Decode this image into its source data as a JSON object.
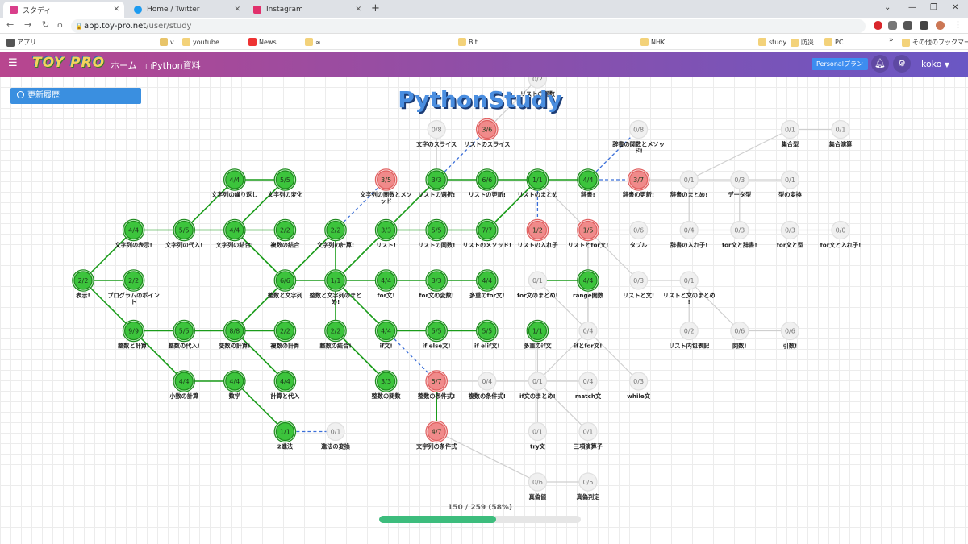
{
  "browser": {
    "tabs": [
      {
        "title": "スタディ",
        "active": true
      },
      {
        "title": "Home / Twitter",
        "active": false
      },
      {
        "title": "Instagram",
        "active": false
      }
    ],
    "url_host": "app.toy-pro.net",
    "url_path": "/user/study"
  },
  "bookmarks": [
    "アプリ",
    "v",
    "youtube",
    "News",
    "∞",
    "Bit",
    "NHK",
    "study",
    "防災",
    "PC",
    "その他のブックマーク"
  ],
  "header": {
    "logo": "TOY PRO",
    "nav": [
      "ホーム",
      "Python資料"
    ],
    "plan_label": "Personalプラン",
    "user_name": "koko"
  },
  "main": {
    "history_button": "更新履歴",
    "title": "PythonStudy",
    "progress_text": "150 / 259 (58%)",
    "progress_fraction": 0.58
  },
  "colors": {
    "completed": "#3cc43c",
    "in_progress": "#f08a8a",
    "not_started": "#f0f0f0",
    "edge_done": "#1a9c1a",
    "edge_todo": "#cfcfcf",
    "edge_link": "#3b6fd8"
  },
  "nodes": [
    {
      "id": "n1",
      "count": "2/2",
      "label": "表示!",
      "status": "done",
      "gx": 1,
      "gy": 4
    },
    {
      "id": "n2",
      "count": "2/2",
      "label": "プログラムのポイント",
      "status": "done",
      "gx": 2,
      "gy": 4
    },
    {
      "id": "n3",
      "count": "4/4",
      "label": "文字列の表示!",
      "status": "done",
      "gx": 2,
      "gy": 3
    },
    {
      "id": "n4",
      "count": "9/9",
      "label": "整数と計算!",
      "status": "done",
      "gx": 2,
      "gy": 5
    },
    {
      "id": "n5",
      "count": "5/5",
      "label": "文字列の代入!",
      "status": "done",
      "gx": 3,
      "gy": 3
    },
    {
      "id": "n6",
      "count": "5/5",
      "label": "整数の代入!",
      "status": "done",
      "gx": 3,
      "gy": 5
    },
    {
      "id": "n7",
      "count": "4/4",
      "label": "小数の計算",
      "status": "done",
      "gx": 3,
      "gy": 6
    },
    {
      "id": "n8",
      "count": "4/4",
      "label": "文字列の繰り返し",
      "status": "done",
      "gx": 4,
      "gy": 2
    },
    {
      "id": "n9",
      "count": "4/4",
      "label": "文字列の結合!",
      "status": "done",
      "gx": 4,
      "gy": 3
    },
    {
      "id": "n10",
      "count": "8/8",
      "label": "変数の計算!",
      "status": "done",
      "gx": 4,
      "gy": 5
    },
    {
      "id": "n11",
      "count": "4/4",
      "label": "数学",
      "status": "done",
      "gx": 4,
      "gy": 6
    },
    {
      "id": "n12",
      "count": "5/5",
      "label": "文字列の変化",
      "status": "done",
      "gx": 5,
      "gy": 2
    },
    {
      "id": "n13",
      "count": "2/2",
      "label": "複数の結合",
      "status": "done",
      "gx": 5,
      "gy": 3
    },
    {
      "id": "n14",
      "count": "6/6",
      "label": "整数と文字列",
      "status": "done",
      "gx": 5,
      "gy": 4
    },
    {
      "id": "n15",
      "count": "2/2",
      "label": "複数の計算",
      "status": "done",
      "gx": 5,
      "gy": 5
    },
    {
      "id": "n16",
      "count": "4/4",
      "label": "計算と代入",
      "status": "done",
      "gx": 5,
      "gy": 6
    },
    {
      "id": "n17",
      "count": "1/1",
      "label": "2進法",
      "status": "done",
      "gx": 5,
      "gy": 7
    },
    {
      "id": "n18",
      "count": "0/1",
      "label": "進法の変換",
      "status": "todo",
      "gx": 6,
      "gy": 7
    },
    {
      "id": "n19",
      "count": "2/2",
      "label": "文字列の計算!",
      "status": "done",
      "gx": 6,
      "gy": 3
    },
    {
      "id": "n20",
      "count": "1/1",
      "label": "整数と文字列のまとめ!",
      "status": "done",
      "gx": 6,
      "gy": 4
    },
    {
      "id": "n21",
      "count": "2/2",
      "label": "整数の結合!",
      "status": "done",
      "gx": 6,
      "gy": 5
    },
    {
      "id": "n22",
      "count": "3/5",
      "label": "文字列の関数とメソッド",
      "status": "prog",
      "gx": 7,
      "gy": 2
    },
    {
      "id": "n23",
      "count": "3/3",
      "label": "リスト!",
      "status": "done",
      "gx": 7,
      "gy": 3
    },
    {
      "id": "n24",
      "count": "4/4",
      "label": "for文!",
      "status": "done",
      "gx": 7,
      "gy": 4
    },
    {
      "id": "n25",
      "count": "4/4",
      "label": "if文!",
      "status": "done",
      "gx": 7,
      "gy": 5
    },
    {
      "id": "n26",
      "count": "3/3",
      "label": "整数の関数",
      "status": "done",
      "gx": 7,
      "gy": 6
    },
    {
      "id": "n27",
      "count": "0/8",
      "label": "文字のスライス",
      "status": "todo",
      "gx": 8,
      "gy": 1
    },
    {
      "id": "n28",
      "count": "3/3",
      "label": "リストの選択!",
      "status": "done",
      "gx": 8,
      "gy": 2
    },
    {
      "id": "n29",
      "count": "5/5",
      "label": "リストの関数!",
      "status": "done",
      "gx": 8,
      "gy": 3
    },
    {
      "id": "n30",
      "count": "3/3",
      "label": "for文の変数!",
      "status": "done",
      "gx": 8,
      "gy": 4
    },
    {
      "id": "n31",
      "count": "5/5",
      "label": "if else文!",
      "status": "done",
      "gx": 8,
      "gy": 5
    },
    {
      "id": "n32",
      "count": "5/7",
      "label": "整数の条件式!",
      "status": "prog",
      "gx": 8,
      "gy": 6
    },
    {
      "id": "n33",
      "count": "4/7",
      "label": "文字列の条件式",
      "status": "prog",
      "gx": 8,
      "gy": 7
    },
    {
      "id": "n34",
      "count": "3/6",
      "label": "リストのスライス",
      "status": "prog",
      "gx": 9,
      "gy": 1
    },
    {
      "id": "n35",
      "count": "6/6",
      "label": "リストの更新!",
      "status": "done",
      "gx": 9,
      "gy": 2
    },
    {
      "id": "n36",
      "count": "7/7",
      "label": "リストのメソッド!",
      "status": "done",
      "gx": 9,
      "gy": 3
    },
    {
      "id": "n37",
      "count": "4/4",
      "label": "多重のfor文!",
      "status": "done",
      "gx": 9,
      "gy": 4
    },
    {
      "id": "n38",
      "count": "5/5",
      "label": "if elif文!",
      "status": "done",
      "gx": 9,
      "gy": 5
    },
    {
      "id": "n39",
      "count": "0/4",
      "label": "複数の条件式!",
      "status": "todo",
      "gx": 9,
      "gy": 6
    },
    {
      "id": "n40",
      "count": "0/2",
      "label": "リストの関数",
      "status": "todo",
      "gx": 10,
      "gy": 0
    },
    {
      "id": "n41",
      "count": "1/1",
      "label": "リストのまとめ",
      "status": "done",
      "gx": 10,
      "gy": 2
    },
    {
      "id": "n42",
      "count": "1/2",
      "label": "リストの入れ子",
      "status": "prog",
      "gx": 10,
      "gy": 3
    },
    {
      "id": "n43",
      "count": "0/1",
      "label": "for文のまとめ!",
      "status": "todo",
      "gx": 10,
      "gy": 4
    },
    {
      "id": "n44",
      "count": "1/1",
      "label": "多重のif文",
      "status": "done",
      "gx": 10,
      "gy": 5
    },
    {
      "id": "n45",
      "count": "0/1",
      "label": "if文のまとめ!",
      "status": "todo",
      "gx": 10,
      "gy": 6
    },
    {
      "id": "n46",
      "count": "0/1",
      "label": "try文",
      "status": "todo",
      "gx": 10,
      "gy": 7
    },
    {
      "id": "n47",
      "count": "0/6",
      "label": "真偽値",
      "status": "todo",
      "gx": 10,
      "gy": 8
    },
    {
      "id": "n48",
      "count": "4/4",
      "label": "辞書!",
      "status": "done",
      "gx": 11,
      "gy": 2
    },
    {
      "id": "n49",
      "count": "1/5",
      "label": "リストとfor文!",
      "status": "prog",
      "gx": 11,
      "gy": 3
    },
    {
      "id": "n50",
      "count": "4/4",
      "label": "range関数",
      "status": "done",
      "gx": 11,
      "gy": 4
    },
    {
      "id": "n51",
      "count": "0/4",
      "label": "ifとfor文!",
      "status": "todo",
      "gx": 11,
      "gy": 5
    },
    {
      "id": "n52",
      "count": "0/4",
      "label": "match文",
      "status": "todo",
      "gx": 11,
      "gy": 6
    },
    {
      "id": "n53",
      "count": "0/1",
      "label": "三項演算子",
      "status": "todo",
      "gx": 11,
      "gy": 7
    },
    {
      "id": "n54",
      "count": "0/5",
      "label": "真偽判定",
      "status": "todo",
      "gx": 11,
      "gy": 8
    },
    {
      "id": "n55",
      "count": "0/8",
      "label": "辞書の関数とメソッド!",
      "status": "todo",
      "gx": 12,
      "gy": 1
    },
    {
      "id": "n56",
      "count": "3/7",
      "label": "辞書の更新!",
      "status": "prog",
      "gx": 12,
      "gy": 2
    },
    {
      "id": "n57",
      "count": "0/6",
      "label": "タプル",
      "status": "todo",
      "gx": 12,
      "gy": 3
    },
    {
      "id": "n58",
      "count": "0/3",
      "label": "リストと文!",
      "status": "todo",
      "gx": 12,
      "gy": 4
    },
    {
      "id": "n59",
      "count": "0/3",
      "label": "while文",
      "status": "todo",
      "gx": 12,
      "gy": 6
    },
    {
      "id": "n60",
      "count": "0/1",
      "label": "辞書のまとめ!",
      "status": "todo",
      "gx": 13,
      "gy": 2
    },
    {
      "id": "n61",
      "count": "0/4",
      "label": "辞書の入れ子!",
      "status": "todo",
      "gx": 13,
      "gy": 3
    },
    {
      "id": "n62",
      "count": "0/1",
      "label": "リストと文のまとめ!",
      "status": "todo",
      "gx": 13,
      "gy": 4
    },
    {
      "id": "n63",
      "count": "0/2",
      "label": "リスト内包表記",
      "status": "todo",
      "gx": 13,
      "gy": 5
    },
    {
      "id": "n64",
      "count": "0/3",
      "label": "データ型",
      "status": "todo",
      "gx": 14,
      "gy": 2
    },
    {
      "id": "n65",
      "count": "0/3",
      "label": "for文と辞書!",
      "status": "todo",
      "gx": 14,
      "gy": 3
    },
    {
      "id": "n66",
      "count": "0/6",
      "label": "関数!",
      "status": "todo",
      "gx": 14,
      "gy": 5
    },
    {
      "id": "n67",
      "count": "0/1",
      "label": "集合型",
      "status": "todo",
      "gx": 15,
      "gy": 1
    },
    {
      "id": "n68",
      "count": "0/1",
      "label": "型の変換",
      "status": "todo",
      "gx": 15,
      "gy": 2
    },
    {
      "id": "n69",
      "count": "0/3",
      "label": "for文と型",
      "status": "todo",
      "gx": 15,
      "gy": 3
    },
    {
      "id": "n70",
      "count": "0/6",
      "label": "引数!",
      "status": "todo",
      "gx": 15,
      "gy": 5
    },
    {
      "id": "n71",
      "count": "0/1",
      "label": "集合演算",
      "status": "todo",
      "gx": 16,
      "gy": 1
    },
    {
      "id": "n72",
      "count": "0/0",
      "label": "for文と入れ子!",
      "status": "todo",
      "gx": 16,
      "gy": 3
    }
  ],
  "edges": [
    [
      "n1",
      "n2",
      "done"
    ],
    [
      "n1",
      "n3",
      "done"
    ],
    [
      "n1",
      "n4",
      "done"
    ],
    [
      "n3",
      "n5",
      "done"
    ],
    [
      "n5",
      "n8",
      "done"
    ],
    [
      "n5",
      "n9",
      "done"
    ],
    [
      "n8",
      "n12",
      "done"
    ],
    [
      "n9",
      "n12",
      "done"
    ],
    [
      "n9",
      "n13",
      "done"
    ],
    [
      "n9",
      "n14",
      "done"
    ],
    [
      "n4",
      "n6",
      "done"
    ],
    [
      "n4",
      "n7",
      "done"
    ],
    [
      "n6",
      "n10",
      "done"
    ],
    [
      "n10",
      "n14",
      "done"
    ],
    [
      "n10",
      "n15",
      "done"
    ],
    [
      "n10",
      "n16",
      "done"
    ],
    [
      "n7",
      "n11",
      "done"
    ],
    [
      "n11",
      "n17",
      "done"
    ],
    [
      "n17",
      "n18",
      "link"
    ],
    [
      "n14",
      "n19",
      "done"
    ],
    [
      "n14",
      "n20",
      "done"
    ],
    [
      "n19",
      "n20",
      "done"
    ],
    [
      "n20",
      "n21",
      "done"
    ],
    [
      "n19",
      "n22",
      "link"
    ],
    [
      "n20",
      "n23",
      "done"
    ],
    [
      "n20",
      "n24",
      "done"
    ],
    [
      "n20",
      "n25",
      "done"
    ],
    [
      "n21",
      "n26",
      "done"
    ],
    [
      "n23",
      "n28",
      "done"
    ],
    [
      "n23",
      "n29",
      "done"
    ],
    [
      "n24",
      "n30",
      "done"
    ],
    [
      "n25",
      "n31",
      "done"
    ],
    [
      "n25",
      "n32",
      "link"
    ],
    [
      "n28",
      "n27",
      "todo"
    ],
    [
      "n28",
      "n34",
      "link"
    ],
    [
      "n28",
      "n35",
      "done"
    ],
    [
      "n29",
      "n36",
      "done"
    ],
    [
      "n30",
      "n37",
      "done"
    ],
    [
      "n31",
      "n38",
      "done"
    ],
    [
      "n32",
      "n39",
      "todo"
    ],
    [
      "n32",
      "n33",
      "done"
    ],
    [
      "n34",
      "n40",
      "todo"
    ],
    [
      "n35",
      "n41",
      "done"
    ],
    [
      "n36",
      "n41",
      "done"
    ],
    [
      "n41",
      "n42",
      "link"
    ],
    [
      "n41",
      "n48",
      "done"
    ],
    [
      "n41",
      "n49",
      "todo"
    ],
    [
      "n43",
      "n50",
      "done"
    ],
    [
      "n43",
      "n51",
      "todo"
    ],
    [
      "n39",
      "n45",
      "todo"
    ],
    [
      "n44",
      "n45",
      "todo"
    ],
    [
      "n45",
      "n46",
      "todo"
    ],
    [
      "n45",
      "n53",
      "todo"
    ],
    [
      "n45",
      "n51",
      "todo"
    ],
    [
      "n45",
      "n52",
      "todo"
    ],
    [
      "n33",
      "n47",
      "todo"
    ],
    [
      "n47",
      "n54",
      "todo"
    ],
    [
      "n48",
      "n55",
      "link"
    ],
    [
      "n48",
      "n56",
      "link"
    ],
    [
      "n49",
      "n57",
      "todo"
    ],
    [
      "n49",
      "n58",
      "todo"
    ],
    [
      "n51",
      "n59",
      "todo"
    ],
    [
      "n56",
      "n60",
      "todo"
    ],
    [
      "n60",
      "n61",
      "todo"
    ],
    [
      "n60",
      "n64",
      "todo"
    ],
    [
      "n60",
      "n67",
      "todo"
    ],
    [
      "n64",
      "n68",
      "todo"
    ],
    [
      "n61",
      "n65",
      "todo"
    ],
    [
      "n65",
      "n69",
      "todo"
    ],
    [
      "n69",
      "n72",
      "todo"
    ],
    [
      "n67",
      "n71",
      "todo"
    ],
    [
      "n62",
      "n63",
      "todo"
    ],
    [
      "n62",
      "n66",
      "todo"
    ],
    [
      "n66",
      "n70",
      "todo"
    ],
    [
      "n64",
      "n65",
      "todo"
    ],
    [
      "n49",
      "n51",
      "todo"
    ],
    [
      "n58",
      "n62",
      "todo"
    ]
  ]
}
